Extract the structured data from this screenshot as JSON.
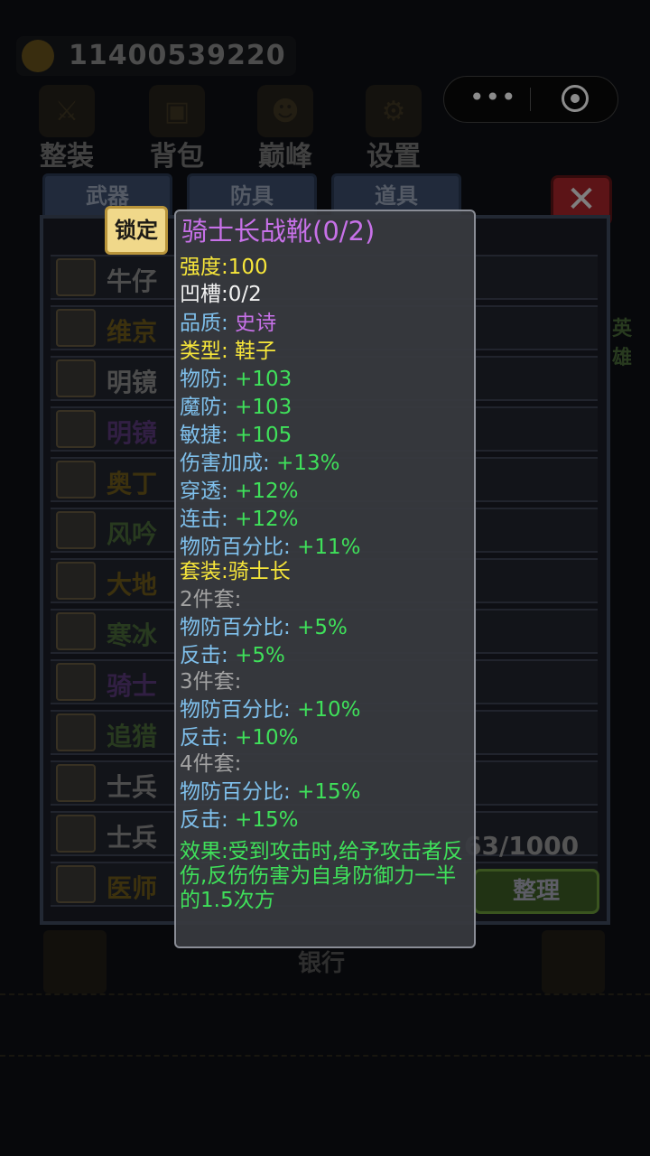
{
  "top": {
    "gold_amount": "11400539220",
    "nav": [
      {
        "label": "整装",
        "icon": "armor-icon"
      },
      {
        "label": "背包",
        "icon": "backpack-icon"
      },
      {
        "label": "巅峰",
        "icon": "peak-icon"
      },
      {
        "label": "设置",
        "icon": "settings-icon"
      }
    ],
    "capsule": {
      "more_icon": "more-dots-icon",
      "close_icon": "target-icon"
    }
  },
  "tabs": [
    {
      "label": "武器"
    },
    {
      "label": "防具"
    },
    {
      "label": "道具"
    }
  ],
  "close_label": "✕",
  "items": [
    {
      "name": "牛仔",
      "color": "#8a8a8a"
    },
    {
      "name": "维京",
      "color": "#6e5a1a"
    },
    {
      "name": "明镜",
      "color": "#8a8a8a"
    },
    {
      "name": "明镜",
      "color": "#5a3a7a"
    },
    {
      "name": "奥丁",
      "color": "#6e5a1a"
    },
    {
      "name": "风吟",
      "color": "#4a6a3a"
    },
    {
      "name": "大地",
      "color": "#6e5a1a"
    },
    {
      "name": "寒冰",
      "color": "#4a6a3a"
    },
    {
      "name": "骑士",
      "color": "#5a3a7a"
    },
    {
      "name": "追猎",
      "color": "#4a6a3a"
    },
    {
      "name": "士兵",
      "color": "#8a8a8a"
    },
    {
      "name": "士兵",
      "color": "#8a8a8a"
    },
    {
      "name": "医师",
      "color": "#6e5a1a"
    }
  ],
  "side": {
    "right_label": "英雄"
  },
  "capacity": "63/1000",
  "sort_label": "整理",
  "bank_label": "银行",
  "lock_label": "锁定",
  "tooltip": {
    "title": "骑士长战靴(0/2)",
    "strength": "强度:100",
    "slots": "凹槽:0/2",
    "quality_label": "品质:",
    "quality_value": "史诗",
    "type": "类型: 鞋子",
    "stats": [
      {
        "label": "物防:",
        "value": "+103"
      },
      {
        "label": "魔防:",
        "value": "+103"
      },
      {
        "label": "敏捷:",
        "value": "+105"
      },
      {
        "label": "伤害加成:",
        "value": "+13%"
      },
      {
        "label": "穿透:",
        "value": "+12%"
      },
      {
        "label": "连击:",
        "value": "+12%"
      },
      {
        "label": "物防百分比:",
        "value": "+11%"
      }
    ],
    "set_name": "套装:骑士长",
    "set_tiers": [
      {
        "header": "2件套:",
        "bonuses": [
          {
            "label": "物防百分比:",
            "value": "+5%"
          },
          {
            "label": "反击:",
            "value": "+5%"
          }
        ]
      },
      {
        "header": "3件套:",
        "bonuses": [
          {
            "label": "物防百分比:",
            "value": "+10%"
          },
          {
            "label": "反击:",
            "value": "+10%"
          }
        ]
      },
      {
        "header": "4件套:",
        "bonuses": [
          {
            "label": "物防百分比:",
            "value": "+15%"
          },
          {
            "label": "反击:",
            "value": "+15%"
          }
        ]
      }
    ],
    "effect": "效果:受到攻击时,给予攻击者反伤,反伤伤害为自身防御力一半的1.5次方"
  }
}
